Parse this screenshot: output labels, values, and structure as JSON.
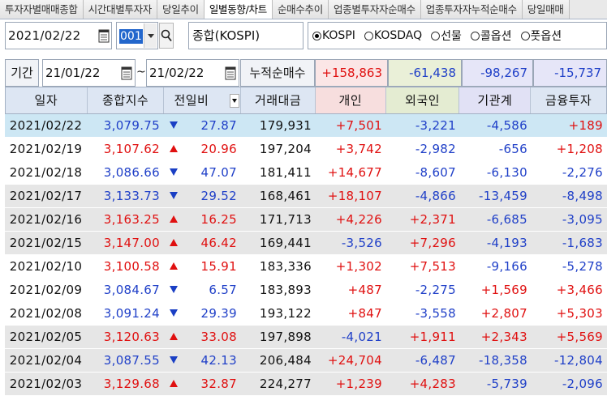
{
  "tabs": [
    "투자자별매매종합",
    "시간대별투자자",
    "당일추이",
    "일별동향/차트",
    "순매수추이",
    "업종별투자자순매수",
    "업종투자자누적순매수",
    "당일매매"
  ],
  "active_tab": 3,
  "controls": {
    "date": "2021/02/22",
    "code": "001",
    "market_name": "종합(KOSPI)",
    "radios": [
      {
        "label": "KOSPI",
        "checked": true
      },
      {
        "label": "KOSDAQ",
        "checked": false
      },
      {
        "label": "선물",
        "checked": false
      },
      {
        "label": "콜옵션",
        "checked": false
      },
      {
        "label": "풋옵션",
        "checked": false
      }
    ]
  },
  "period": {
    "label": "기간",
    "from": "21/01/22",
    "tilde": "~",
    "to": "21/02/22",
    "cumulative_label": "누적순매수",
    "cumulative_values": [
      "+158,863",
      "-61,438",
      "-98,267",
      "-15,737"
    ]
  },
  "colors": {
    "up": "#e01010",
    "down": "#2040c8",
    "header_bg": "#dde6f3",
    "selected_row": "#cde7f4",
    "alt_row": "#e6e6e6"
  },
  "table": {
    "headers": [
      "일자",
      "종합지수",
      "전일비",
      "거래대금",
      "개인",
      "외국인",
      "기관계",
      "금융투자"
    ],
    "rows": [
      {
        "date": "2021/02/22",
        "index": "3,079.75",
        "dir": "down",
        "chg": "27.87",
        "amount": "179,931",
        "indiv": "+7,501",
        "foreign": "-3,221",
        "inst": "-4,586",
        "fin": "+189"
      },
      {
        "date": "2021/02/19",
        "index": "3,107.62",
        "dir": "up",
        "chg": "20.96",
        "amount": "197,204",
        "indiv": "+3,742",
        "foreign": "-2,982",
        "inst": "-656",
        "fin": "+1,208"
      },
      {
        "date": "2021/02/18",
        "index": "3,086.66",
        "dir": "down",
        "chg": "47.07",
        "amount": "181,411",
        "indiv": "+14,677",
        "foreign": "-8,607",
        "inst": "-6,130",
        "fin": "-2,276"
      },
      {
        "date": "2021/02/17",
        "index": "3,133.73",
        "dir": "down",
        "chg": "29.52",
        "amount": "168,461",
        "indiv": "+18,107",
        "foreign": "-4,866",
        "inst": "-13,459",
        "fin": "-8,498"
      },
      {
        "date": "2021/02/16",
        "index": "3,163.25",
        "dir": "up",
        "chg": "16.25",
        "amount": "171,713",
        "indiv": "+4,226",
        "foreign": "+2,371",
        "inst": "-6,685",
        "fin": "-3,095"
      },
      {
        "date": "2021/02/15",
        "index": "3,147.00",
        "dir": "up",
        "chg": "46.42",
        "amount": "169,441",
        "indiv": "-3,526",
        "foreign": "+7,296",
        "inst": "-4,193",
        "fin": "-1,683"
      },
      {
        "date": "2021/02/10",
        "index": "3,100.58",
        "dir": "up",
        "chg": "15.91",
        "amount": "183,336",
        "indiv": "+1,302",
        "foreign": "+7,513",
        "inst": "-9,166",
        "fin": "-5,278"
      },
      {
        "date": "2021/02/09",
        "index": "3,084.67",
        "dir": "down",
        "chg": "6.57",
        "amount": "183,893",
        "indiv": "+487",
        "foreign": "-2,275",
        "inst": "+1,569",
        "fin": "+3,466"
      },
      {
        "date": "2021/02/08",
        "index": "3,091.24",
        "dir": "down",
        "chg": "29.39",
        "amount": "193,122",
        "indiv": "+847",
        "foreign": "-3,558",
        "inst": "+2,807",
        "fin": "+5,303"
      },
      {
        "date": "2021/02/05",
        "index": "3,120.63",
        "dir": "up",
        "chg": "33.08",
        "amount": "197,898",
        "indiv": "-4,021",
        "foreign": "+1,911",
        "inst": "+2,343",
        "fin": "+5,569"
      },
      {
        "date": "2021/02/04",
        "index": "3,087.55",
        "dir": "down",
        "chg": "42.13",
        "amount": "206,484",
        "indiv": "+24,704",
        "foreign": "-6,487",
        "inst": "-18,358",
        "fin": "-12,804"
      },
      {
        "date": "2021/02/03",
        "index": "3,129.68",
        "dir": "up",
        "chg": "32.87",
        "amount": "224,277",
        "indiv": "+1,239",
        "foreign": "+4,283",
        "inst": "-5,739",
        "fin": "-2,096"
      }
    ]
  }
}
